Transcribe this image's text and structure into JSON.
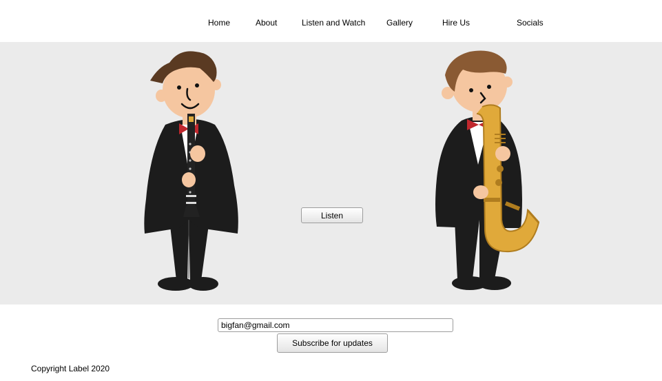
{
  "nav": {
    "items": [
      {
        "label": "Home"
      },
      {
        "label": "About"
      },
      {
        "label": "Listen and Watch"
      },
      {
        "label": "Gallery"
      },
      {
        "label": "Hire Us"
      },
      {
        "label": "Socials"
      }
    ]
  },
  "hero": {
    "listen_label": "Listen",
    "illustrations": [
      "clarinet-player",
      "saxophone-player"
    ]
  },
  "subscribe": {
    "email_value": "bigfan@gmail.com",
    "button_label": "Subscribe for updates"
  },
  "footer": {
    "copyright": "Copyright Label 2020"
  },
  "colors": {
    "hero_bg": "#ebebeb",
    "tuxedo": "#1c1c1c",
    "bowtie": "#c0272d",
    "skin": "#f5c6a0",
    "hair": "#5a3a22",
    "sax_gold": "#e0a93a"
  }
}
